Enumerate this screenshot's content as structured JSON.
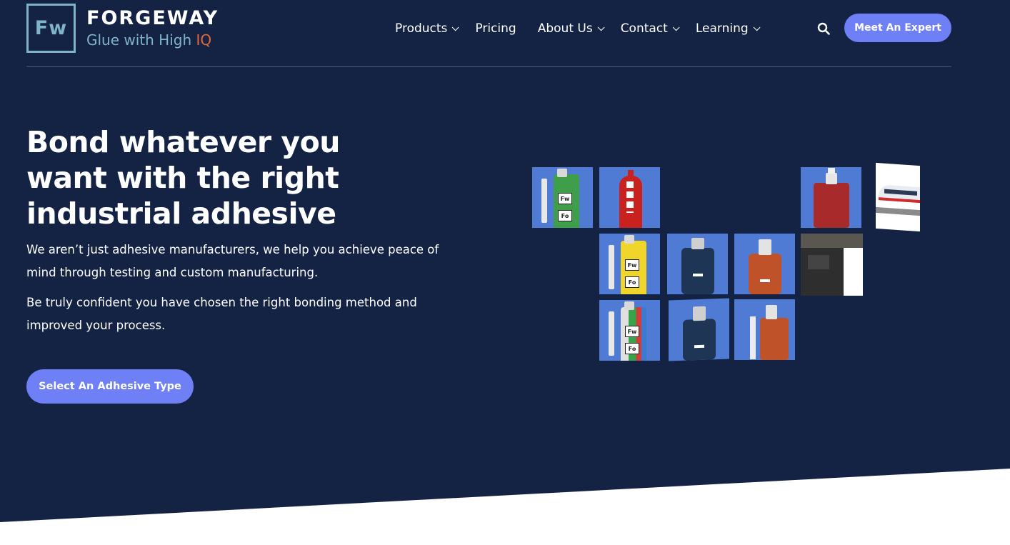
{
  "brand": {
    "mark": "Fw",
    "name": "FORGEWAY",
    "tagline_main": "Glue with High ",
    "tagline_iq": "IQ",
    "mark_color": "#7fb3c7",
    "iq_color": "#e2683c"
  },
  "nav": {
    "items": [
      {
        "label": "Products",
        "has_dropdown": true
      },
      {
        "label": "Pricing",
        "has_dropdown": false
      },
      {
        "label": "About Us",
        "has_dropdown": true
      },
      {
        "label": "Contact",
        "has_dropdown": true
      },
      {
        "label": "Learning",
        "has_dropdown": true
      }
    ],
    "search_icon": "search-icon",
    "cta_label": "Meet An Expert"
  },
  "hero": {
    "headline": "Bond whatever you want with the right industrial adhesive",
    "paragraph_1": "We aren’t just adhesive manufacturers, we help you achieve peace of mind through testing and custom manufacturing.",
    "paragraph_2": "Be truly confident you have chosen the right bonding method and improved your process.",
    "cta_label": "Select An Adhesive Type"
  },
  "colors": {
    "background": "#142244",
    "accent": "#6f7ff5",
    "tile_blue": "#4f7bd4"
  }
}
